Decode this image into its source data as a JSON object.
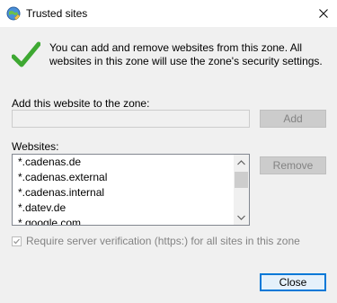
{
  "window": {
    "title": "Trusted sites"
  },
  "info": {
    "text": "You can add and remove websites from this zone. All websites in this zone will use the zone's security settings."
  },
  "add_section": {
    "label": "Add this website to the zone:",
    "input_value": "",
    "add_button": "Add"
  },
  "websites": {
    "label": "Websites:",
    "items": [
      "*.cadenas.de",
      "*.cadenas.external",
      "*.cadenas.internal",
      "*.datev.de",
      "*.google.com"
    ],
    "remove_button": "Remove"
  },
  "require_https": {
    "label": "Require server verification (https:) for all sites in this zone",
    "checked": true,
    "enabled": false
  },
  "footer": {
    "close_button": "Close"
  },
  "colors": {
    "check_green": "#3ea832",
    "focus_blue": "#0078d7",
    "disabled_text": "#838383"
  }
}
